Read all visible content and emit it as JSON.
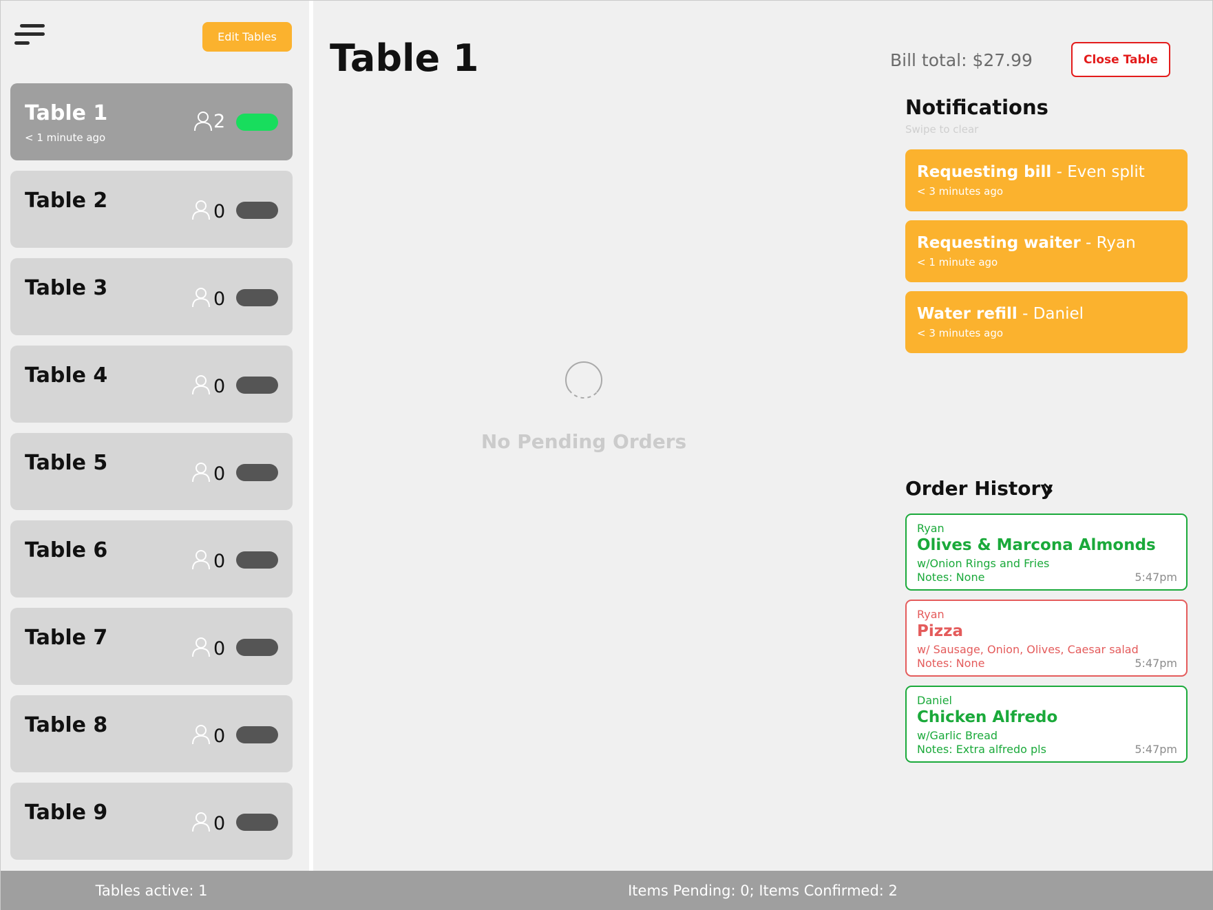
{
  "sidebar": {
    "edit_button": "Edit Tables",
    "tables": [
      {
        "name": "Table 1",
        "subtitle": "< 1 minute ago",
        "guests": "2",
        "active": true
      },
      {
        "name": "Table 2",
        "subtitle": "",
        "guests": "0",
        "active": false
      },
      {
        "name": "Table 3",
        "subtitle": "",
        "guests": "0",
        "active": false
      },
      {
        "name": "Table 4",
        "subtitle": "",
        "guests": "0",
        "active": false
      },
      {
        "name": "Table 5",
        "subtitle": "",
        "guests": "0",
        "active": false
      },
      {
        "name": "Table 6",
        "subtitle": "",
        "guests": "0",
        "active": false
      },
      {
        "name": "Table 7",
        "subtitle": "",
        "guests": "0",
        "active": false
      },
      {
        "name": "Table 8",
        "subtitle": "",
        "guests": "0",
        "active": false
      },
      {
        "name": "Table 9",
        "subtitle": "",
        "guests": "0",
        "active": false
      }
    ]
  },
  "main": {
    "title": "Table 1",
    "bill_total": "Bill total: $27.99",
    "close_button": "Close Table",
    "empty_state": "No Pending Orders"
  },
  "notifications": {
    "heading": "Notifications",
    "hint": "Swipe to clear",
    "items": [
      {
        "title": "Requesting bill",
        "detail": " - Even split",
        "time": "< 3 minutes ago"
      },
      {
        "title": "Requesting waiter",
        "detail": " - Ryan",
        "time": "< 1 minute ago"
      },
      {
        "title": "Water refill",
        "detail": " - Daniel",
        "time": "< 3 minutes ago"
      }
    ]
  },
  "order_history": {
    "heading": "Order History",
    "items": [
      {
        "name": "Ryan",
        "item": "Olives & Marcona Almonds",
        "sides": "w/Onion Rings and Fries",
        "notes": "Notes: None",
        "time": "5:47pm",
        "status": "confirmed"
      },
      {
        "name": "Ryan",
        "item": "Pizza",
        "sides": "w/ Sausage, Onion, Olives, Caesar salad",
        "notes": "Notes: None",
        "time": "5:47pm",
        "status": "rejected"
      },
      {
        "name": "Daniel",
        "item": "Chicken Alfredo",
        "sides": "w/Garlic Bread",
        "notes": "Notes: Extra alfredo pls",
        "time": "5:47pm",
        "status": "confirmed"
      }
    ]
  },
  "footer": {
    "tables_active": "Tables active: 1",
    "items_status": "Items Pending: 0; Items Confirmed: 2"
  },
  "colors": {
    "accent": "#fbb22e",
    "active_toggle": "#18dd5d",
    "inactive_toggle": "#555555",
    "danger": "#e31b1b",
    "confirmed": "#1aa93a",
    "rejected": "#e45b5b"
  },
  "icons": {
    "menu": "menu-icon",
    "guests": "person-icon",
    "loading": "spinner-icon",
    "history": "chevron-right-icon"
  }
}
